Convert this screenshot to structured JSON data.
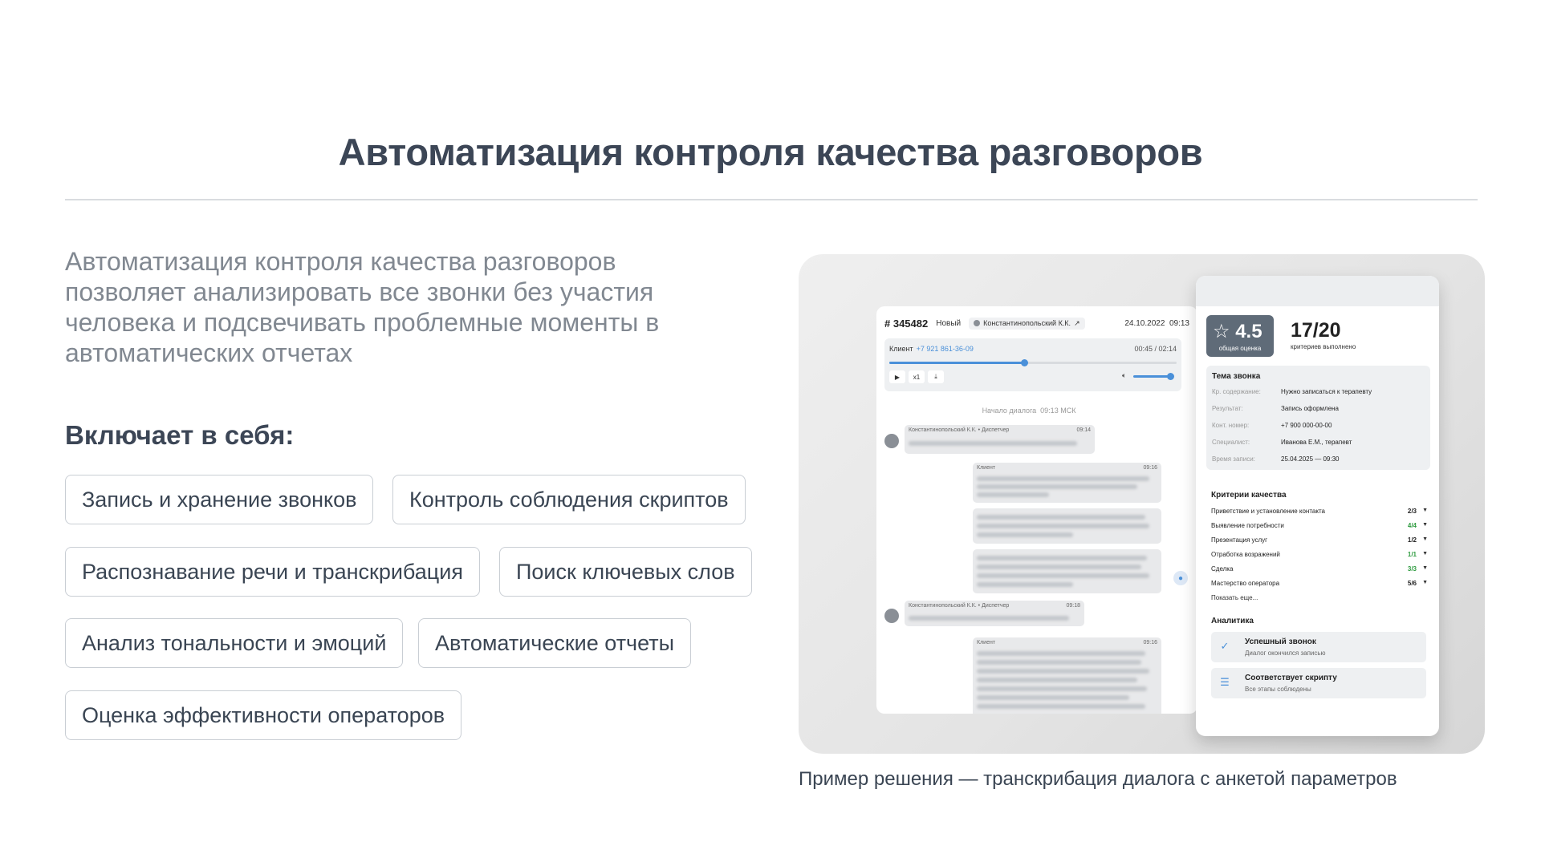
{
  "title": "Автоматизация контроля качества разговоров",
  "description": "Автоматизация контроля качества разговоров позволяет анализировать все звонки без участия человека и подсвечивать проблемные моменты в автоматических отчетах",
  "includes_heading": "Включает в себя:",
  "features": [
    "Запись и хранение звонков",
    "Контроль соблюдения скриптов",
    "Распознавание речи и транскрибация",
    "Поиск ключевых слов",
    "Анализ тональности и эмоций",
    "Автоматические отчеты",
    "Оценка эффективности операторов"
  ],
  "caption": "Пример решения — транскрибация диалога с анкетой параметров",
  "dialog": {
    "number": "# 345482",
    "status": "Новый",
    "operator": "Константинопольский К.К.",
    "date": "24.10.2022",
    "time": "09:13",
    "client_label": "Клиент",
    "client_phone": "+7 921 861-36-09",
    "playback_time": "00:45 / 02:14",
    "playback_progress": 0.47,
    "speed_label": "x1",
    "dialog_start": "Начало диалога",
    "dialog_start_time": "09:13 МСК",
    "messages": [
      {
        "author": "Константинопольский К.К. • Диспетчер",
        "time": "09:14"
      },
      {
        "author": "Клиент",
        "time": "09:16"
      },
      {
        "author": "Константинопольский К.К. • Диспетчер",
        "time": "09:18"
      },
      {
        "author": "Клиент",
        "time": "09:16"
      }
    ]
  },
  "report": {
    "score": "4.5",
    "score_label": "общая оценка",
    "criteria_count": "17/20",
    "criteria_label": "критериев выполнено",
    "topic_heading": "Тема звонка",
    "topic_rows": [
      {
        "k": "Кр. содержание:",
        "v": "Нужно записаться к терапевту"
      },
      {
        "k": "Результат:",
        "v": "Запись оформлена"
      },
      {
        "k": "Конт. номер:",
        "v": "+7 900 000-00-00"
      },
      {
        "k": "Специалист:",
        "v": "Иванова Е.М., терапевт"
      },
      {
        "k": "Время записи:",
        "v": "25.04.2025 — 09:30"
      }
    ],
    "quality_heading": "Критерии качества",
    "quality_rows": [
      {
        "name": "Приветствие и установление контакта",
        "score": "2/3",
        "color": "#222222"
      },
      {
        "name": "Выявление потребности",
        "score": "4/4",
        "color": "#2e9b3f"
      },
      {
        "name": "Презентация услуг",
        "score": "1/2",
        "color": "#222222"
      },
      {
        "name": "Отработка возражений",
        "score": "1/1",
        "color": "#2e9b3f"
      },
      {
        "name": "Сделка",
        "score": "3/3",
        "color": "#2e9b3f"
      },
      {
        "name": "Мастерство оператора",
        "score": "5/6",
        "color": "#222222"
      }
    ],
    "show_more": "Показать еще...",
    "analytics_heading": "Аналитика",
    "analytics": [
      {
        "title": "Успешный звонок",
        "subtitle": "Диалог окончился записью"
      },
      {
        "title": "Соответствует скрипту",
        "subtitle": "Все этапы соблюдены"
      }
    ]
  }
}
